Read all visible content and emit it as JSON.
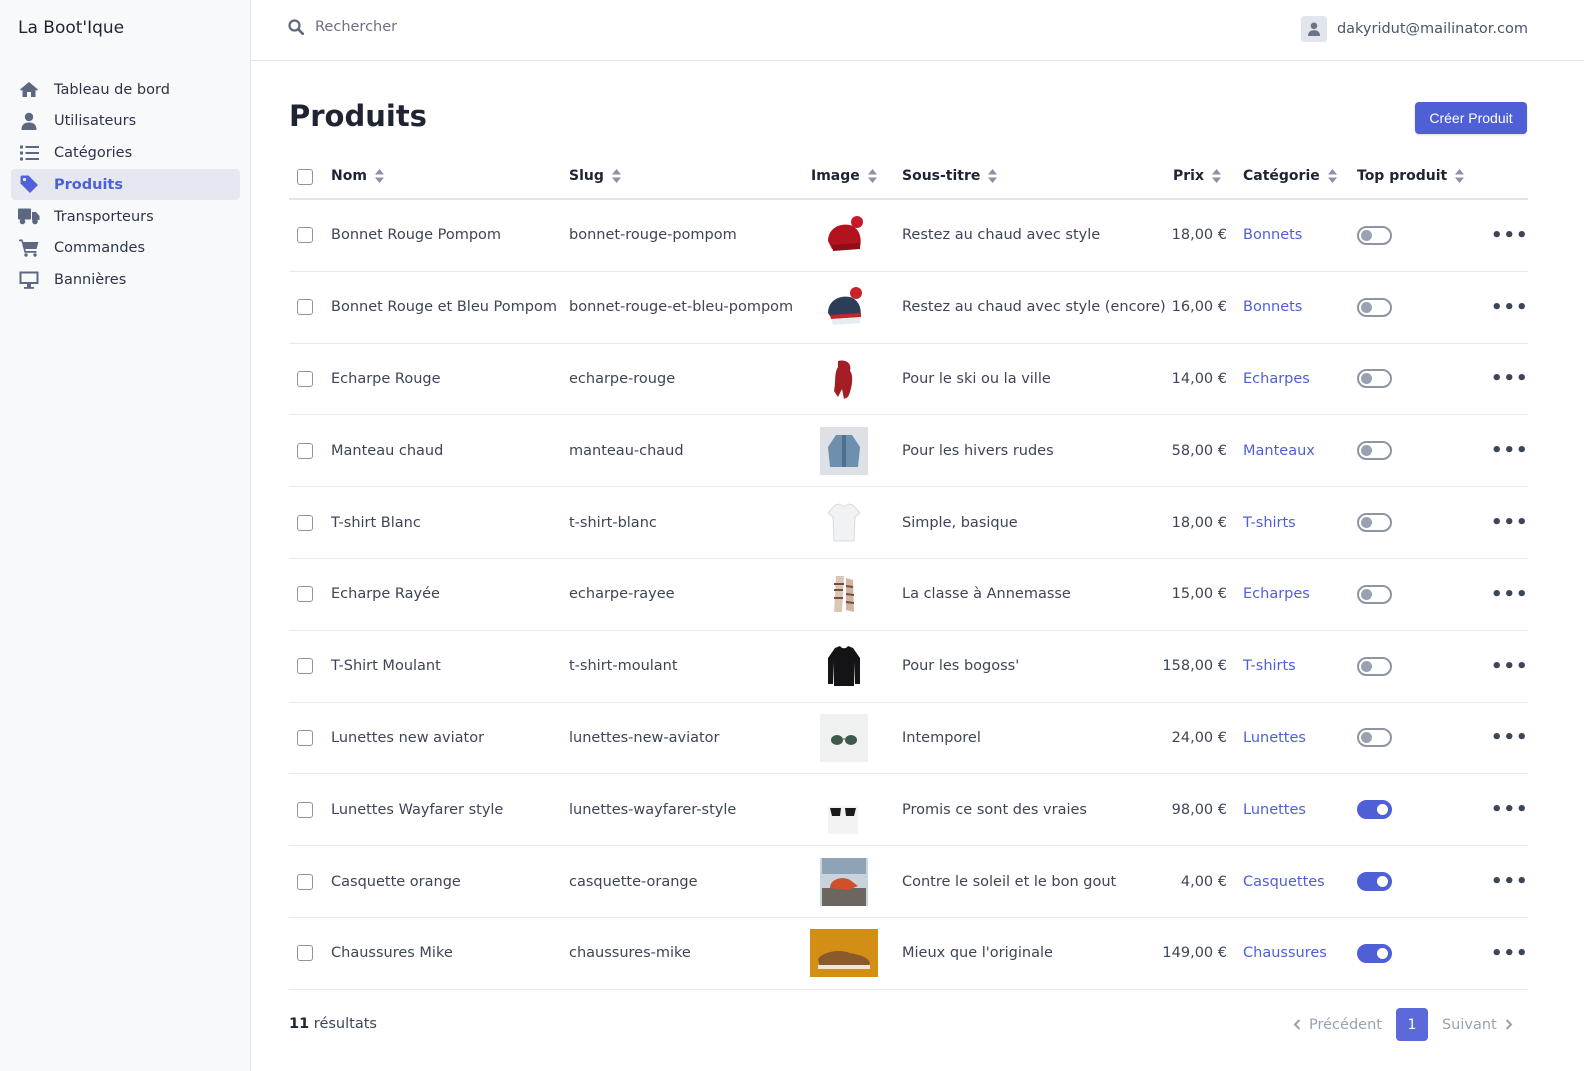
{
  "app": {
    "title": "La Boot'Ique"
  },
  "sidebar": {
    "items": [
      {
        "label": "Tableau de bord",
        "icon": "home-icon"
      },
      {
        "label": "Utilisateurs",
        "icon": "user-icon"
      },
      {
        "label": "Catégories",
        "icon": "list-icon"
      },
      {
        "label": "Produits",
        "icon": "tag-icon",
        "active": true
      },
      {
        "label": "Transporteurs",
        "icon": "truck-icon"
      },
      {
        "label": "Commandes",
        "icon": "cart-icon"
      },
      {
        "label": "Bannières",
        "icon": "desktop-icon"
      }
    ]
  },
  "topbar": {
    "search_placeholder": "Rechercher",
    "user_email": "dakyridut@mailinator.com"
  },
  "page": {
    "title": "Produits",
    "create_button": "Créer Produit"
  },
  "table": {
    "headers": {
      "name": "Nom",
      "slug": "Slug",
      "image": "Image",
      "subtitle": "Sous-titre",
      "price": "Prix",
      "category": "Catégorie",
      "top": "Top produit"
    },
    "rows": [
      {
        "name": "Bonnet Rouge Pompom",
        "slug": "bonnet-rouge-pompom",
        "subtitle": "Restez au chaud avec style",
        "price": "18,00 €",
        "category": "Bonnets",
        "top": false,
        "thumb": "red-beanie"
      },
      {
        "name": "Bonnet Rouge et Bleu Pompom",
        "slug": "bonnet-rouge-et-bleu-pompom",
        "subtitle": "Restez au chaud avec style (encore)",
        "price": "16,00 €",
        "category": "Bonnets",
        "top": false,
        "thumb": "blue-red-beanie"
      },
      {
        "name": "Echarpe Rouge",
        "slug": "echarpe-rouge",
        "subtitle": "Pour le ski ou la ville",
        "price": "14,00 €",
        "category": "Echarpes",
        "top": false,
        "thumb": "red-scarf"
      },
      {
        "name": "Manteau chaud",
        "slug": "manteau-chaud",
        "subtitle": "Pour les hivers rudes",
        "price": "58,00 €",
        "category": "Manteaux",
        "top": false,
        "thumb": "coat"
      },
      {
        "name": "T-shirt Blanc",
        "slug": "t-shirt-blanc",
        "subtitle": "Simple, basique",
        "price": "18,00 €",
        "category": "T-shirts",
        "top": false,
        "thumb": "white-tshirt"
      },
      {
        "name": "Echarpe Rayée",
        "slug": "echarpe-rayee",
        "subtitle": "La classe à Annemasse",
        "price": "15,00 €",
        "category": "Echarpes",
        "top": false,
        "thumb": "striped-scarf"
      },
      {
        "name": "T-Shirt Moulant",
        "slug": "t-shirt-moulant",
        "subtitle": "Pour les bogoss'",
        "price": "158,00 €",
        "category": "T-shirts",
        "top": false,
        "thumb": "black-shirt"
      },
      {
        "name": "Lunettes new aviator",
        "slug": "lunettes-new-aviator",
        "subtitle": "Intemporel",
        "price": "24,00 €",
        "category": "Lunettes",
        "top": false,
        "thumb": "aviator"
      },
      {
        "name": "Lunettes Wayfarer style",
        "slug": "lunettes-wayfarer-style",
        "subtitle": "Promis ce sont des vraies",
        "price": "98,00 €",
        "category": "Lunettes",
        "top": true,
        "thumb": "wayfarer"
      },
      {
        "name": "Casquette orange",
        "slug": "casquette-orange",
        "subtitle": "Contre le soleil et le bon gout",
        "price": "4,00 €",
        "category": "Casquettes",
        "top": true,
        "thumb": "cap"
      },
      {
        "name": "Chaussures Mike",
        "slug": "chaussures-mike",
        "subtitle": "Mieux que l'originale",
        "price": "149,00 €",
        "category": "Chaussures",
        "top": true,
        "thumb": "shoes"
      }
    ]
  },
  "footer": {
    "count": "11",
    "count_label": " résultats",
    "prev": "Précédent",
    "page": "1",
    "next": "Suivant"
  },
  "colors": {
    "accent": "#4f5fd6",
    "sidebar_bg": "#f8f9fb"
  }
}
